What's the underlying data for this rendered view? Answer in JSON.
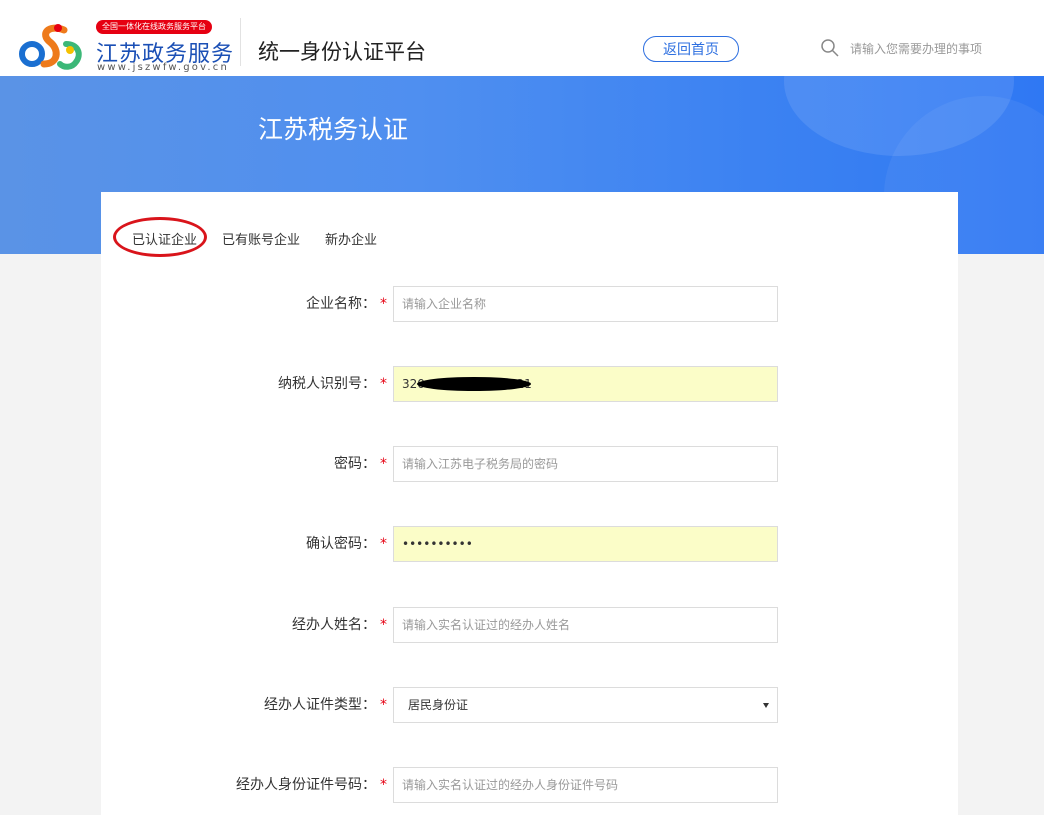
{
  "header": {
    "logo_badge": "全国一体化在线政务服务平台",
    "logo_name": "江苏政务服务",
    "logo_url": "www.jszwfw.gov.cn",
    "platform_title": "统一身份认证平台",
    "home_button_label": "返回首页",
    "search_placeholder": "请输入您需要办理的事项",
    "search_icon": "search-icon"
  },
  "banner": {
    "title": "江苏税务认证"
  },
  "tabs": [
    {
      "label": "已认证企业",
      "active": true
    },
    {
      "label": "已有账号企业",
      "active": false
    },
    {
      "label": "新办企业",
      "active": false
    }
  ],
  "form": {
    "required_mark": "*",
    "fields": [
      {
        "label": "企业名称：",
        "placeholder": "请输入企业名称",
        "value": ""
      },
      {
        "label": "纳税人识别号：",
        "placeholder": "",
        "value": "320                        21"
      },
      {
        "label": "密码：",
        "placeholder": "请输入江苏电子税务局的密码",
        "value": ""
      },
      {
        "label": "确认密码：",
        "placeholder": "",
        "value": "••••••••••"
      },
      {
        "label": "经办人姓名：",
        "placeholder": "请输入实名认证过的经办人姓名",
        "value": ""
      },
      {
        "label": "经办人证件类型：",
        "selected": "居民身份证"
      },
      {
        "label": "经办人身份证件号码：",
        "placeholder": "请输入实名认证过的经办人身份证件号码",
        "value": ""
      }
    ]
  },
  "colors": {
    "brand_blue": "#2d6fe0",
    "required_red": "#e60012",
    "autofill_yellow": "#fbfdc8",
    "annotation_red": "#d9141b"
  }
}
